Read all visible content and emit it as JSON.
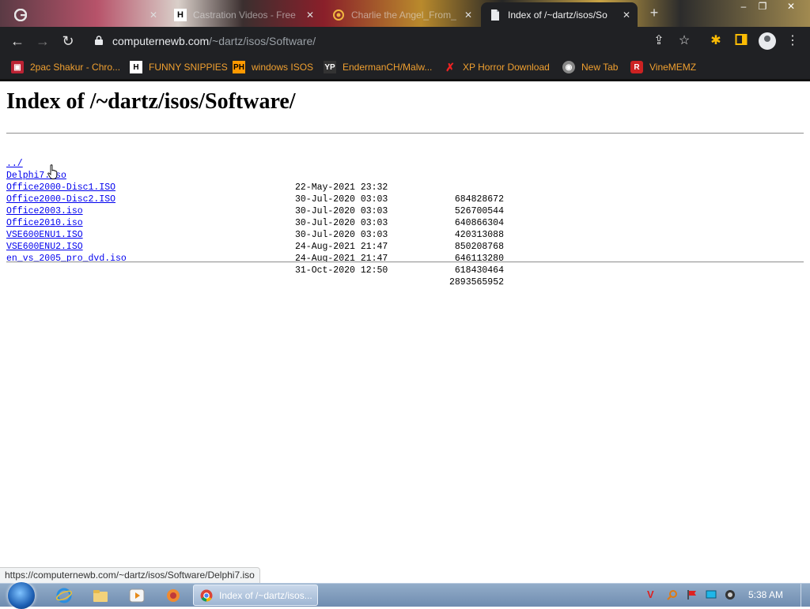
{
  "browser": {
    "tabs": [
      {
        "title": "",
        "favicon": "google-icon",
        "active": false
      },
      {
        "title": "Castration Videos - Free",
        "favicon": "h-icon",
        "active": false
      },
      {
        "title": "Charlie the Angel_From_",
        "favicon": "spiral-icon",
        "active": false
      },
      {
        "title": "Index of /~dartz/isos/So",
        "favicon": "page-icon",
        "active": true
      }
    ],
    "url_host": "computernewb.com",
    "url_path": "/~dartz/isos/Software/",
    "bookmarks": [
      {
        "label": "2pac Shakur - Chro...",
        "icon": "bookmark-icon"
      },
      {
        "label": "FUNNY SNIPPIES",
        "icon": "h-icon"
      },
      {
        "label": "windows ISOS",
        "icon": "ph-icon"
      },
      {
        "label": "EndermanCH/Malw...",
        "icon": "yp-icon"
      },
      {
        "label": "XP Horror Download",
        "icon": "x-icon"
      },
      {
        "label": "New Tab",
        "icon": "globe-icon"
      },
      {
        "label": "VineMEMZ",
        "icon": "r-icon"
      }
    ],
    "status_url": "https://computernewb.com/~dartz/isos/Software/Delphi7.iso"
  },
  "page": {
    "title": "Index of /~dartz/isos/Software/",
    "parent_link": "../",
    "files": [
      {
        "name": "Delphi7.iso",
        "date": "22-May-2021 23:32",
        "size": "684828672"
      },
      {
        "name": "Office2000-Disc1.ISO",
        "date": "30-Jul-2020 03:03",
        "size": "526700544"
      },
      {
        "name": "Office2000-Disc2.ISO",
        "date": "30-Jul-2020 03:03",
        "size": "640866304"
      },
      {
        "name": "Office2003.iso",
        "date": "30-Jul-2020 03:03",
        "size": "420313088"
      },
      {
        "name": "Office2010.iso",
        "date": "30-Jul-2020 03:03",
        "size": "850208768"
      },
      {
        "name": "VSE600ENU1.ISO",
        "date": "24-Aug-2021 21:47",
        "size": "646113280"
      },
      {
        "name": "VSE600ENU2.ISO",
        "date": "24-Aug-2021 21:47",
        "size": "618430464"
      },
      {
        "name": "en_vs_2005_pro_dvd.iso",
        "date": "31-Oct-2020 12:50",
        "size": "2893565952"
      }
    ]
  },
  "taskbar": {
    "active_window": "Index of /~dartz/isos...",
    "clock": "5:38 AM"
  },
  "colors": {
    "link": "#0000ee",
    "bookmark_text": "#f0a030",
    "browser_dark": "#202124",
    "taskbar": "#7f9bbd"
  }
}
